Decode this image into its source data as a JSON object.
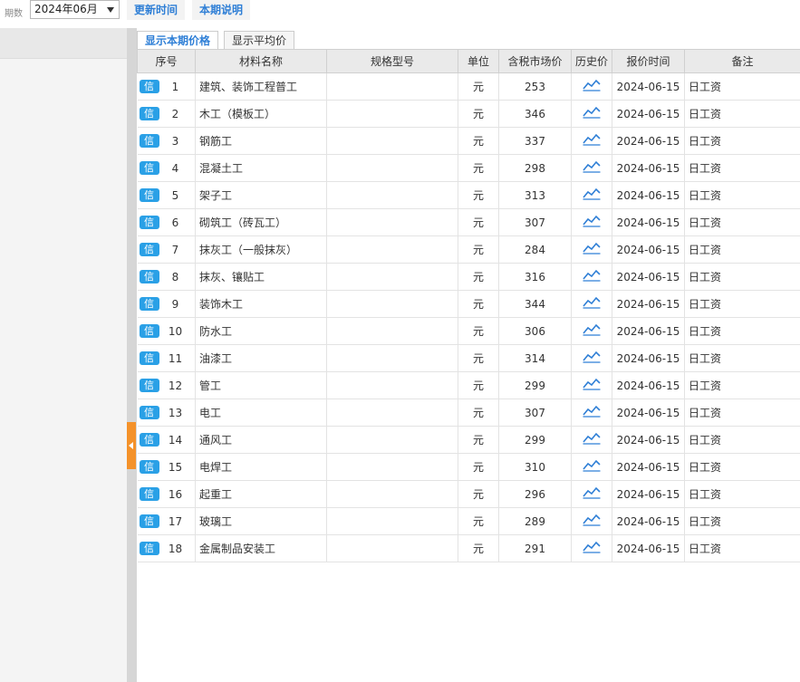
{
  "topbar": {
    "period_label": "期数",
    "period_value": "2024年06月",
    "update_time_label": "更新时间",
    "period_note_label": "本期说明"
  },
  "tabs": [
    {
      "label": "显示本期价格",
      "active": true
    },
    {
      "label": "显示平均价",
      "active": false
    }
  ],
  "table": {
    "headers": [
      "序号",
      "材料名称",
      "规格型号",
      "单位",
      "含税市场价",
      "历史价",
      "报价时间",
      "备注"
    ],
    "badge_label": "信",
    "rows": [
      {
        "seq": "1",
        "name": "建筑、装饰工程普工",
        "spec": "",
        "unit": "元",
        "price": "253",
        "date": "2024-06-15",
        "note": "日工资"
      },
      {
        "seq": "2",
        "name": "木工（模板工）",
        "spec": "",
        "unit": "元",
        "price": "346",
        "date": "2024-06-15",
        "note": "日工资"
      },
      {
        "seq": "3",
        "name": "钢筋工",
        "spec": "",
        "unit": "元",
        "price": "337",
        "date": "2024-06-15",
        "note": "日工资"
      },
      {
        "seq": "4",
        "name": "混凝土工",
        "spec": "",
        "unit": "元",
        "price": "298",
        "date": "2024-06-15",
        "note": "日工资"
      },
      {
        "seq": "5",
        "name": "架子工",
        "spec": "",
        "unit": "元",
        "price": "313",
        "date": "2024-06-15",
        "note": "日工资"
      },
      {
        "seq": "6",
        "name": "砌筑工（砖瓦工）",
        "spec": "",
        "unit": "元",
        "price": "307",
        "date": "2024-06-15",
        "note": "日工资"
      },
      {
        "seq": "7",
        "name": "抹灰工（一般抹灰）",
        "spec": "",
        "unit": "元",
        "price": "284",
        "date": "2024-06-15",
        "note": "日工资"
      },
      {
        "seq": "8",
        "name": "抹灰、镶贴工",
        "spec": "",
        "unit": "元",
        "price": "316",
        "date": "2024-06-15",
        "note": "日工资"
      },
      {
        "seq": "9",
        "name": "装饰木工",
        "spec": "",
        "unit": "元",
        "price": "344",
        "date": "2024-06-15",
        "note": "日工资"
      },
      {
        "seq": "10",
        "name": "防水工",
        "spec": "",
        "unit": "元",
        "price": "306",
        "date": "2024-06-15",
        "note": "日工资"
      },
      {
        "seq": "11",
        "name": "油漆工",
        "spec": "",
        "unit": "元",
        "price": "314",
        "date": "2024-06-15",
        "note": "日工资"
      },
      {
        "seq": "12",
        "name": "管工",
        "spec": "",
        "unit": "元",
        "price": "299",
        "date": "2024-06-15",
        "note": "日工资"
      },
      {
        "seq": "13",
        "name": "电工",
        "spec": "",
        "unit": "元",
        "price": "307",
        "date": "2024-06-15",
        "note": "日工资"
      },
      {
        "seq": "14",
        "name": "通风工",
        "spec": "",
        "unit": "元",
        "price": "299",
        "date": "2024-06-15",
        "note": "日工资"
      },
      {
        "seq": "15",
        "name": "电焊工",
        "spec": "",
        "unit": "元",
        "price": "310",
        "date": "2024-06-15",
        "note": "日工资"
      },
      {
        "seq": "16",
        "name": "起重工",
        "spec": "",
        "unit": "元",
        "price": "296",
        "date": "2024-06-15",
        "note": "日工资"
      },
      {
        "seq": "17",
        "name": "玻璃工",
        "spec": "",
        "unit": "元",
        "price": "289",
        "date": "2024-06-15",
        "note": "日工资"
      },
      {
        "seq": "18",
        "name": "金属制品安装工",
        "spec": "",
        "unit": "元",
        "price": "291",
        "date": "2024-06-15",
        "note": "日工资"
      }
    ]
  },
  "icons": {
    "history": "line-chart-icon",
    "collapse": "collapse-left-icon",
    "dropdown": "chevron-down-icon"
  },
  "colors": {
    "accent": "#2f7fd6",
    "badge": "#2aa0e6",
    "handle": "#f4922a"
  }
}
